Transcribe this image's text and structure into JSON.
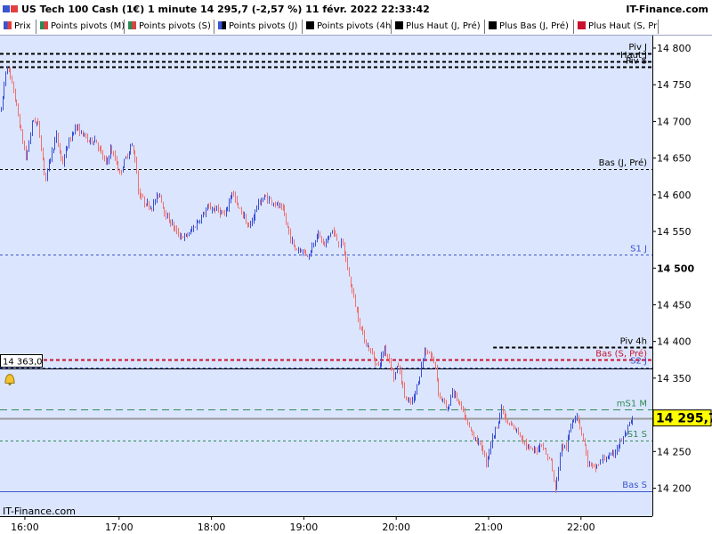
{
  "title": "US Tech 100 Cash (1€) 1 minute 14 295,7 (-2,57 %) 11 févr. 2022 22:33:42",
  "brand": "IT-Finance.com",
  "watermark": "IT-Finance.com",
  "legend": [
    {
      "label": "Prix",
      "color": "#3a55d0",
      "color2": "#e04040"
    },
    {
      "label": "Points pivots (M)",
      "color": "#2e8b57",
      "color2": "#e04040"
    },
    {
      "label": "Points pivots (S)",
      "color": "#2e8b57",
      "color2": "#e04040"
    },
    {
      "label": "Points pivots (J)",
      "color": "#3a55d0",
      "color2": "#000000"
    },
    {
      "label": "Points pivots (4h)",
      "color": "#000000",
      "color2": "#000000"
    },
    {
      "label": "Plus Haut (J, Pré)",
      "color": "#000000",
      "color2": "#000000"
    },
    {
      "label": "Plus Bas (J, Pré)",
      "color": "#000000",
      "color2": "#000000"
    },
    {
      "label": "Plus Haut (S, Pr",
      "color": "#c8102e",
      "color2": "#c8102e"
    }
  ],
  "colors": {
    "plot_bg": "#dbe5fd",
    "up": "#3a4fd6",
    "down": "#f07070",
    "black": "#000000",
    "blue": "#3a55d0",
    "green": "#2e8b57",
    "red": "#c8102e",
    "price_line": "#1e6fd9",
    "gray_line": "#9a9a9a"
  },
  "price_box": "14 295,7",
  "crosshair_label": "14 363,0",
  "chart_data": {
    "type": "candlestick",
    "y_range": [
      14175,
      14815
    ],
    "x_ticks": [
      {
        "label": "16:00",
        "t": 15.98
      },
      {
        "label": "17:00",
        "t": 17.0
      },
      {
        "label": "18:00",
        "t": 18.0
      },
      {
        "label": "19:00",
        "t": 19.0
      },
      {
        "label": "20:00",
        "t": 20.0
      },
      {
        "label": "21:00",
        "t": 21.0
      },
      {
        "label": "22:00",
        "t": 22.0
      }
    ],
    "y_ticks": [
      {
        "value": 14800,
        "label": "14 800",
        "bold": false
      },
      {
        "value": 14750,
        "label": "14 750",
        "bold": false
      },
      {
        "value": 14700,
        "label": "14 700",
        "bold": false
      },
      {
        "value": 14650,
        "label": "14 650",
        "bold": false
      },
      {
        "value": 14600,
        "label": "14 600",
        "bold": false
      },
      {
        "value": 14550,
        "label": "14 550",
        "bold": false
      },
      {
        "value": 14500,
        "label": "14 500",
        "bold": true
      },
      {
        "value": 14450,
        "label": "14 450",
        "bold": false
      },
      {
        "value": 14400,
        "label": "14 400",
        "bold": false
      },
      {
        "value": 14350,
        "label": "14 350",
        "bold": false
      },
      {
        "value": 14250,
        "label": "14 250",
        "bold": false
      },
      {
        "value": 14200,
        "label": "14 200",
        "bold": false
      }
    ],
    "last_price": 14295.7,
    "crosshair_price": 14363.0,
    "levels": [
      {
        "name": "Piv J",
        "value": 14793,
        "color": "black",
        "dash": "4,3",
        "width": 2,
        "label_color": "black"
      },
      {
        "name": "Haut J",
        "value": 14782,
        "color": "black",
        "dash": "4,3",
        "width": 2,
        "label_color": "black"
      },
      {
        "name": "Piv S",
        "value": 14774,
        "color": "black",
        "dash": "4,3",
        "width": 2,
        "label_color": "black"
      },
      {
        "name": "Bas (J, Pré)",
        "value": 14635,
        "color": "black",
        "dash": "3,3",
        "width": 1,
        "label_color": "black"
      },
      {
        "name": "S1 J",
        "value": 14518,
        "color": "blue",
        "dash": "3,3",
        "width": 1,
        "label_color": "blue"
      },
      {
        "name": "Piv 4h",
        "value": 14392,
        "color": "black",
        "dash": "4,3",
        "width": 2,
        "label_color": "black",
        "x_start_time": 21.05
      },
      {
        "name": "Bas (S, Pré)",
        "value": 14375,
        "color": "red",
        "dash": "4,3",
        "width": 2,
        "label_color": "red"
      },
      {
        "name": "S2 J",
        "value": 14365,
        "color": "blue",
        "dash": "3,3",
        "width": 1,
        "label_color": "blue"
      },
      {
        "name": "mS1 M",
        "value": 14307,
        "color": "green",
        "dash": "8,5",
        "width": 1,
        "label_color": "green"
      },
      {
        "name": "S1 S",
        "value": 14265,
        "color": "green",
        "dash": "3,3",
        "width": 1,
        "label_color": "green"
      },
      {
        "name": "Bas S",
        "value": 14196,
        "color": "blue",
        "dash": "",
        "width": 1,
        "label_color": "blue"
      }
    ],
    "price_anchors": [
      [
        15.72,
        14715
      ],
      [
        15.78,
        14779
      ],
      [
        15.86,
        14738
      ],
      [
        15.94,
        14682
      ],
      [
        15.99,
        14648
      ],
      [
        16.06,
        14703
      ],
      [
        16.12,
        14697
      ],
      [
        16.17,
        14648
      ],
      [
        16.2,
        14621
      ],
      [
        16.26,
        14655
      ],
      [
        16.32,
        14680
      ],
      [
        16.38,
        14642
      ],
      [
        16.44,
        14668
      ],
      [
        16.52,
        14693
      ],
      [
        16.6,
        14683
      ],
      [
        16.67,
        14673
      ],
      [
        16.74,
        14676
      ],
      [
        16.82,
        14651
      ],
      [
        16.86,
        14641
      ],
      [
        16.9,
        14663
      ],
      [
        16.97,
        14645
      ],
      [
        17.0,
        14628
      ],
      [
        17.05,
        14644
      ],
      [
        17.13,
        14669
      ],
      [
        17.18,
        14644
      ],
      [
        17.2,
        14605
      ],
      [
        17.27,
        14590
      ],
      [
        17.35,
        14583
      ],
      [
        17.43,
        14603
      ],
      [
        17.5,
        14572
      ],
      [
        17.58,
        14558
      ],
      [
        17.63,
        14546
      ],
      [
        17.71,
        14542
      ],
      [
        17.78,
        14551
      ],
      [
        17.88,
        14569
      ],
      [
        17.96,
        14582
      ],
      [
        18.06,
        14580
      ],
      [
        18.14,
        14571
      ],
      [
        18.22,
        14605
      ],
      [
        18.28,
        14583
      ],
      [
        18.35,
        14571
      ],
      [
        18.4,
        14553
      ],
      [
        18.5,
        14588
      ],
      [
        18.58,
        14597
      ],
      [
        18.68,
        14589
      ],
      [
        18.77,
        14578
      ],
      [
        18.85,
        14542
      ],
      [
        18.9,
        14526
      ],
      [
        18.97,
        14525
      ],
      [
        19.05,
        14517
      ],
      [
        19.14,
        14548
      ],
      [
        19.22,
        14531
      ],
      [
        19.3,
        14552
      ],
      [
        19.37,
        14534
      ],
      [
        19.42,
        14532
      ],
      [
        19.48,
        14492
      ],
      [
        19.54,
        14457
      ],
      [
        19.6,
        14424
      ],
      [
        19.67,
        14397
      ],
      [
        19.75,
        14379
      ],
      [
        19.8,
        14365
      ],
      [
        19.87,
        14391
      ],
      [
        19.92,
        14375
      ],
      [
        19.97,
        14352
      ],
      [
        20.02,
        14368
      ],
      [
        20.08,
        14330
      ],
      [
        20.12,
        14316
      ],
      [
        20.18,
        14319
      ],
      [
        20.25,
        14353
      ],
      [
        20.3,
        14387
      ],
      [
        20.36,
        14384
      ],
      [
        20.42,
        14366
      ],
      [
        20.46,
        14325
      ],
      [
        20.5,
        14321
      ],
      [
        20.55,
        14304
      ],
      [
        20.6,
        14334
      ],
      [
        20.68,
        14315
      ],
      [
        20.75,
        14293
      ],
      [
        20.8,
        14278
      ],
      [
        20.88,
        14263
      ],
      [
        20.93,
        14254
      ],
      [
        20.97,
        14235
      ],
      [
        21.02,
        14261
      ],
      [
        21.08,
        14284
      ],
      [
        21.14,
        14308
      ],
      [
        21.2,
        14287
      ],
      [
        21.28,
        14282
      ],
      [
        21.35,
        14271
      ],
      [
        21.42,
        14254
      ],
      [
        21.5,
        14250
      ],
      [
        21.57,
        14262
      ],
      [
        21.62,
        14246
      ],
      [
        21.67,
        14237
      ],
      [
        21.72,
        14196
      ],
      [
        21.78,
        14256
      ],
      [
        21.84,
        14257
      ],
      [
        21.9,
        14292
      ],
      [
        21.95,
        14302
      ],
      [
        22.02,
        14268
      ],
      [
        22.07,
        14235
      ],
      [
        22.14,
        14226
      ],
      [
        22.2,
        14236
      ],
      [
        22.28,
        14243
      ],
      [
        22.33,
        14243
      ],
      [
        22.38,
        14254
      ],
      [
        22.45,
        14268
      ],
      [
        22.5,
        14280
      ],
      [
        22.56,
        14295.7
      ]
    ]
  }
}
